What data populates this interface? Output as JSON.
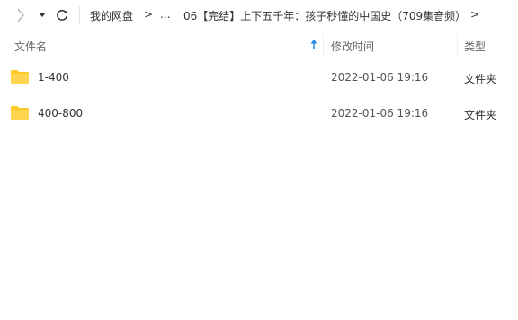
{
  "toolbar": {
    "back_icon": "chevron-right-icon",
    "dropdown_icon": "caret-down-icon",
    "refresh_icon": "refresh-icon",
    "breadcrumbs": [
      {
        "label": "我的网盘"
      },
      {
        "label": ">"
      },
      {
        "label": "..."
      },
      {
        "label": "06【完结】上下五千年：孩子秒懂的中国史（709集音频）"
      },
      {
        "label": ">"
      }
    ]
  },
  "columns": {
    "name": "文件名",
    "modified": "修改时间",
    "type": "类型",
    "sort_icon": "arrow-up-icon"
  },
  "files": [
    {
      "name": "1-400",
      "modified": "2022-01-06 19:16",
      "type": "文件夹",
      "icon": "folder-icon"
    },
    {
      "name": "400-800",
      "modified": "2022-01-06 19:16",
      "type": "文件夹",
      "icon": "folder-icon"
    }
  ],
  "colors": {
    "folder": "#ffca28",
    "sort_arrow": "#1e88e5"
  }
}
